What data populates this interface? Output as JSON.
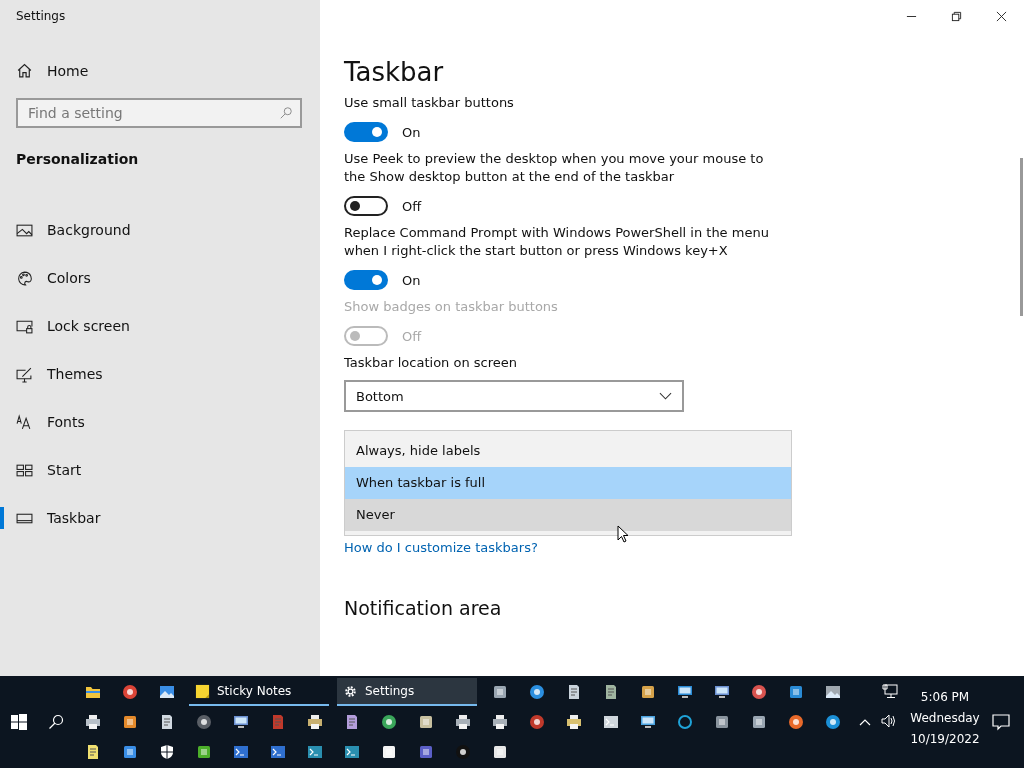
{
  "window": {
    "title": "Settings"
  },
  "sidebar": {
    "home": "Home",
    "search": {
      "placeholder": "Find a setting"
    },
    "section": "Personalization",
    "items": [
      {
        "label": "Background",
        "selected": false
      },
      {
        "label": "Colors",
        "selected": false
      },
      {
        "label": "Lock screen",
        "selected": false
      },
      {
        "label": "Themes",
        "selected": false
      },
      {
        "label": "Fonts",
        "selected": false
      },
      {
        "label": "Start",
        "selected": false
      },
      {
        "label": "Taskbar",
        "selected": true
      }
    ]
  },
  "main": {
    "title": "Taskbar",
    "settings": [
      {
        "kind": "toggle",
        "label": "Use small taskbar buttons",
        "on": true,
        "disabled": false,
        "state": "On"
      },
      {
        "kind": "toggle",
        "label": "Use Peek to preview the desktop when you move your mouse to the Show desktop button at the end of the taskbar",
        "on": false,
        "disabled": false,
        "state": "Off"
      },
      {
        "kind": "toggle",
        "label": "Replace Command Prompt with Windows PowerShell in the menu when I right-click the start button or press Windows key+X",
        "on": true,
        "disabled": false,
        "state": "On"
      },
      {
        "kind": "toggle",
        "label": "Show badges on taskbar buttons",
        "on": false,
        "disabled": true,
        "state": "Off"
      },
      {
        "kind": "dropdown",
        "label": "Taskbar location on screen",
        "value": "Bottom"
      }
    ],
    "popup": {
      "options": [
        {
          "label": "Always, hide labels",
          "selected": false,
          "hovered": false
        },
        {
          "label": "When taskbar is full",
          "selected": true,
          "hovered": false
        },
        {
          "label": "Never",
          "selected": false,
          "hovered": true
        }
      ]
    },
    "link": "How do I customize taskbars?",
    "section": "Notification area"
  },
  "taskbar": {
    "buttons": [
      {
        "label": "Sticky Notes",
        "active": false
      },
      {
        "label": "Settings",
        "active": true
      }
    ],
    "clock": {
      "time": "5:06 PM",
      "day": "Wednesday",
      "date": "10/19/2022"
    }
  }
}
